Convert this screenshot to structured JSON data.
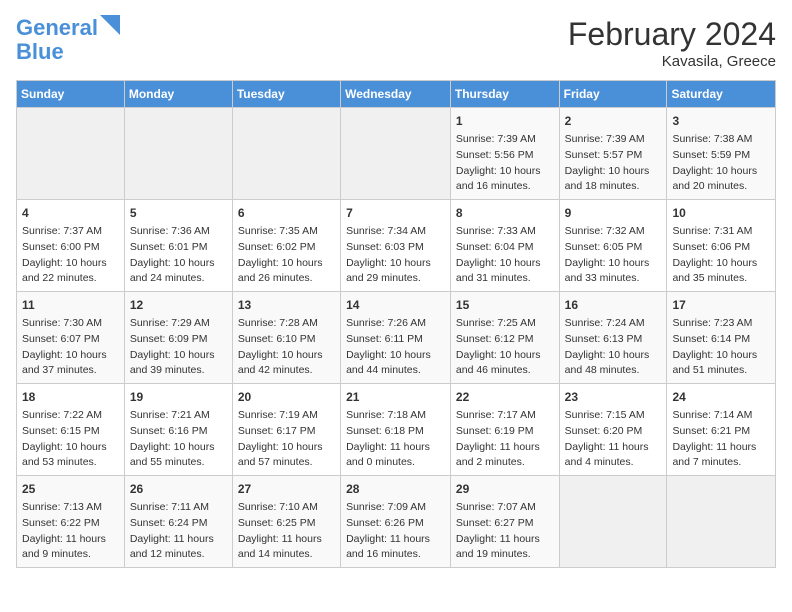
{
  "header": {
    "logo_line1": "General",
    "logo_line2": "Blue",
    "title": "February 2024",
    "subtitle": "Kavasila, Greece"
  },
  "days_of_week": [
    "Sunday",
    "Monday",
    "Tuesday",
    "Wednesday",
    "Thursday",
    "Friday",
    "Saturday"
  ],
  "weeks": [
    [
      {
        "day": "",
        "content": ""
      },
      {
        "day": "",
        "content": ""
      },
      {
        "day": "",
        "content": ""
      },
      {
        "day": "",
        "content": ""
      },
      {
        "day": "1",
        "content": "Sunrise: 7:39 AM\nSunset: 5:56 PM\nDaylight: 10 hours\nand 16 minutes."
      },
      {
        "day": "2",
        "content": "Sunrise: 7:39 AM\nSunset: 5:57 PM\nDaylight: 10 hours\nand 18 minutes."
      },
      {
        "day": "3",
        "content": "Sunrise: 7:38 AM\nSunset: 5:59 PM\nDaylight: 10 hours\nand 20 minutes."
      }
    ],
    [
      {
        "day": "4",
        "content": "Sunrise: 7:37 AM\nSunset: 6:00 PM\nDaylight: 10 hours\nand 22 minutes."
      },
      {
        "day": "5",
        "content": "Sunrise: 7:36 AM\nSunset: 6:01 PM\nDaylight: 10 hours\nand 24 minutes."
      },
      {
        "day": "6",
        "content": "Sunrise: 7:35 AM\nSunset: 6:02 PM\nDaylight: 10 hours\nand 26 minutes."
      },
      {
        "day": "7",
        "content": "Sunrise: 7:34 AM\nSunset: 6:03 PM\nDaylight: 10 hours\nand 29 minutes."
      },
      {
        "day": "8",
        "content": "Sunrise: 7:33 AM\nSunset: 6:04 PM\nDaylight: 10 hours\nand 31 minutes."
      },
      {
        "day": "9",
        "content": "Sunrise: 7:32 AM\nSunset: 6:05 PM\nDaylight: 10 hours\nand 33 minutes."
      },
      {
        "day": "10",
        "content": "Sunrise: 7:31 AM\nSunset: 6:06 PM\nDaylight: 10 hours\nand 35 minutes."
      }
    ],
    [
      {
        "day": "11",
        "content": "Sunrise: 7:30 AM\nSunset: 6:07 PM\nDaylight: 10 hours\nand 37 minutes."
      },
      {
        "day": "12",
        "content": "Sunrise: 7:29 AM\nSunset: 6:09 PM\nDaylight: 10 hours\nand 39 minutes."
      },
      {
        "day": "13",
        "content": "Sunrise: 7:28 AM\nSunset: 6:10 PM\nDaylight: 10 hours\nand 42 minutes."
      },
      {
        "day": "14",
        "content": "Sunrise: 7:26 AM\nSunset: 6:11 PM\nDaylight: 10 hours\nand 44 minutes."
      },
      {
        "day": "15",
        "content": "Sunrise: 7:25 AM\nSunset: 6:12 PM\nDaylight: 10 hours\nand 46 minutes."
      },
      {
        "day": "16",
        "content": "Sunrise: 7:24 AM\nSunset: 6:13 PM\nDaylight: 10 hours\nand 48 minutes."
      },
      {
        "day": "17",
        "content": "Sunrise: 7:23 AM\nSunset: 6:14 PM\nDaylight: 10 hours\nand 51 minutes."
      }
    ],
    [
      {
        "day": "18",
        "content": "Sunrise: 7:22 AM\nSunset: 6:15 PM\nDaylight: 10 hours\nand 53 minutes."
      },
      {
        "day": "19",
        "content": "Sunrise: 7:21 AM\nSunset: 6:16 PM\nDaylight: 10 hours\nand 55 minutes."
      },
      {
        "day": "20",
        "content": "Sunrise: 7:19 AM\nSunset: 6:17 PM\nDaylight: 10 hours\nand 57 minutes."
      },
      {
        "day": "21",
        "content": "Sunrise: 7:18 AM\nSunset: 6:18 PM\nDaylight: 11 hours\nand 0 minutes."
      },
      {
        "day": "22",
        "content": "Sunrise: 7:17 AM\nSunset: 6:19 PM\nDaylight: 11 hours\nand 2 minutes."
      },
      {
        "day": "23",
        "content": "Sunrise: 7:15 AM\nSunset: 6:20 PM\nDaylight: 11 hours\nand 4 minutes."
      },
      {
        "day": "24",
        "content": "Sunrise: 7:14 AM\nSunset: 6:21 PM\nDaylight: 11 hours\nand 7 minutes."
      }
    ],
    [
      {
        "day": "25",
        "content": "Sunrise: 7:13 AM\nSunset: 6:22 PM\nDaylight: 11 hours\nand 9 minutes."
      },
      {
        "day": "26",
        "content": "Sunrise: 7:11 AM\nSunset: 6:24 PM\nDaylight: 11 hours\nand 12 minutes."
      },
      {
        "day": "27",
        "content": "Sunrise: 7:10 AM\nSunset: 6:25 PM\nDaylight: 11 hours\nand 14 minutes."
      },
      {
        "day": "28",
        "content": "Sunrise: 7:09 AM\nSunset: 6:26 PM\nDaylight: 11 hours\nand 16 minutes."
      },
      {
        "day": "29",
        "content": "Sunrise: 7:07 AM\nSunset: 6:27 PM\nDaylight: 11 hours\nand 19 minutes."
      },
      {
        "day": "",
        "content": ""
      },
      {
        "day": "",
        "content": ""
      }
    ]
  ]
}
